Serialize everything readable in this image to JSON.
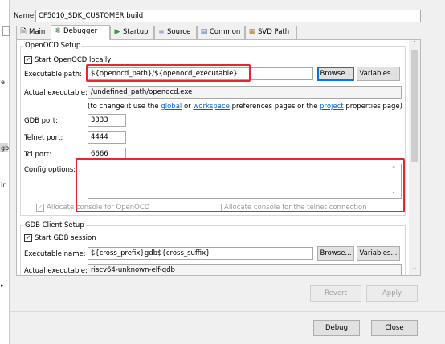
{
  "left_strip": {
    "fragments": [
      "e",
      "gb",
      "ir",
      "a"
    ]
  },
  "name_field": {
    "label": "Name:",
    "value": "CF5010_SDK_CUSTOMER build"
  },
  "tabs": [
    {
      "label": "Main",
      "icon": "document-icon"
    },
    {
      "label": "Debugger",
      "icon": "debug-gear-icon"
    },
    {
      "label": "Startup",
      "icon": "play-icon"
    },
    {
      "label": "Source",
      "icon": "source-icon"
    },
    {
      "label": "Common",
      "icon": "window-icon"
    },
    {
      "label": "SVD Path",
      "icon": "registers-icon"
    }
  ],
  "openocd": {
    "title": "OpenOCD Setup",
    "start_locally": "Start OpenOCD locally",
    "exe_path_label": "Executable path:",
    "exe_path_value": "${openocd_path}/${openocd_executable}",
    "browse": "Browse...",
    "variables": "Variables...",
    "actual_exe_label": "Actual executable:",
    "actual_exe_value": "/undefined_path/openocd.exe",
    "hint_prefix": "(to change it use the",
    "hint_global": "global",
    "hint_or": "or",
    "hint_workspace": "workspace",
    "hint_middle": "preferences pages or the",
    "hint_project": "project",
    "hint_suffix": "properties page)",
    "gdb_port_label": "GDB port:",
    "gdb_port_value": "3333",
    "telnet_port_label": "Telnet port:",
    "telnet_port_value": "4444",
    "tcl_port_label": "Tcl port:",
    "tcl_port_value": "6666",
    "config_label": "Config options:",
    "config_value": "",
    "alloc_console": "Allocate console for OpenOCD",
    "alloc_telnet": "Allocate console for the telnet connection"
  },
  "gdb_client": {
    "title": "GDB Client Setup",
    "start_session": "Start GDB session",
    "exe_name_label": "Executable name:",
    "exe_name_value": "${cross_prefix}gdb${cross_suffix}",
    "browse": "Browse...",
    "variables": "Variables...",
    "actual_exe_label": "Actual executable:",
    "actual_exe_value": "riscv64-unknown-elf-gdb"
  },
  "buttons": {
    "revert": "Revert",
    "apply": "Apply",
    "debug": "Debug",
    "close": "Close"
  }
}
